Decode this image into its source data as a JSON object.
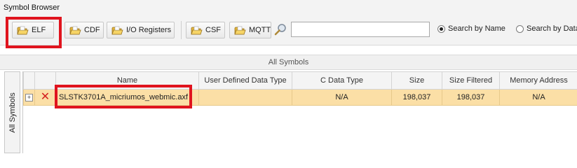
{
  "window": {
    "title": "Symbol Browser"
  },
  "toolbar": {
    "buttons": [
      {
        "label": "ELF",
        "icon": "folder-open-icon"
      },
      {
        "label": "CDF",
        "icon": "folder-open-icon"
      },
      {
        "label": "I/O Registers",
        "icon": "folder-open-icon"
      },
      {
        "label": "CSF",
        "icon": "folder-open-icon"
      },
      {
        "label": "MQTT",
        "icon": "folder-open-icon"
      }
    ],
    "search": {
      "icon": "magnifier-icon",
      "value": "",
      "placeholder": ""
    },
    "radios": [
      {
        "label": "Search by Name",
        "selected": true
      },
      {
        "label": "Search by Data",
        "selected": false
      }
    ]
  },
  "panel": {
    "header": "All Symbols",
    "side_tab": "All Symbols"
  },
  "table": {
    "columns": [
      "",
      "",
      "Name",
      "User Defined Data Type",
      "C Data Type",
      "Size",
      "Size Filtered",
      "Memory Address"
    ],
    "rows": [
      {
        "expander": "+",
        "status_icon": "✕",
        "name": "SLSTK3701A_micriumos_webmic.axf",
        "user_defined_data_type": "",
        "c_data_type": "N/A",
        "size": "198,037",
        "size_filtered": "198,037",
        "memory_address": "N/A"
      }
    ]
  },
  "colors": {
    "highlight": "#e0141e",
    "row_selected": "#fbdfa6",
    "status_error": "#d42020"
  }
}
